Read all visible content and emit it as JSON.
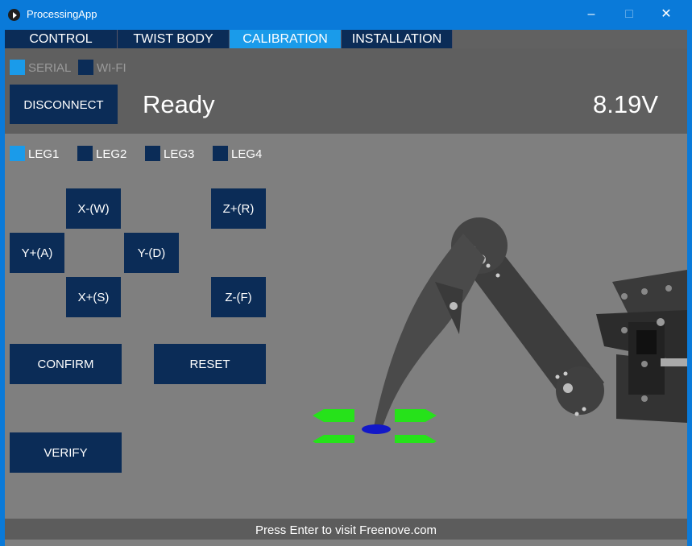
{
  "window": {
    "title": "ProcessingApp",
    "controls": {
      "minimize": "–",
      "maximize": "□",
      "close": "✕"
    }
  },
  "tabs": [
    {
      "label": "CONTROL"
    },
    {
      "label": "TWIST BODY"
    },
    {
      "label": "CALIBRATION",
      "active": true
    },
    {
      "label": "INSTALLATION"
    }
  ],
  "connection": {
    "serial_label": "SERIAL",
    "serial_selected": true,
    "wifi_label": "WI-FI",
    "wifi_selected": false,
    "disconnect_label": "DISCONNECT",
    "status": "Ready",
    "voltage": "8.19V"
  },
  "legs": [
    {
      "label": "LEG1",
      "selected": true
    },
    {
      "label": "LEG2",
      "selected": false
    },
    {
      "label": "LEG3",
      "selected": false
    },
    {
      "label": "LEG4",
      "selected": false
    }
  ],
  "buttons": {
    "x_minus": "X-(W)",
    "z_plus": "Z+(R)",
    "y_plus": "Y+(A)",
    "y_minus": "Y-(D)",
    "x_plus": "X+(S)",
    "z_minus": "Z-(F)",
    "confirm": "CONFIRM",
    "reset": "RESET",
    "verify": "VERIFY"
  },
  "footer": "Press Enter to visit Freenove.com",
  "colors": {
    "accent": "#1a9bea",
    "button": "#0b2c57",
    "title_bar": "#0a7ad9",
    "arrow": "#26e21a",
    "foot_marker": "#1218c8"
  }
}
